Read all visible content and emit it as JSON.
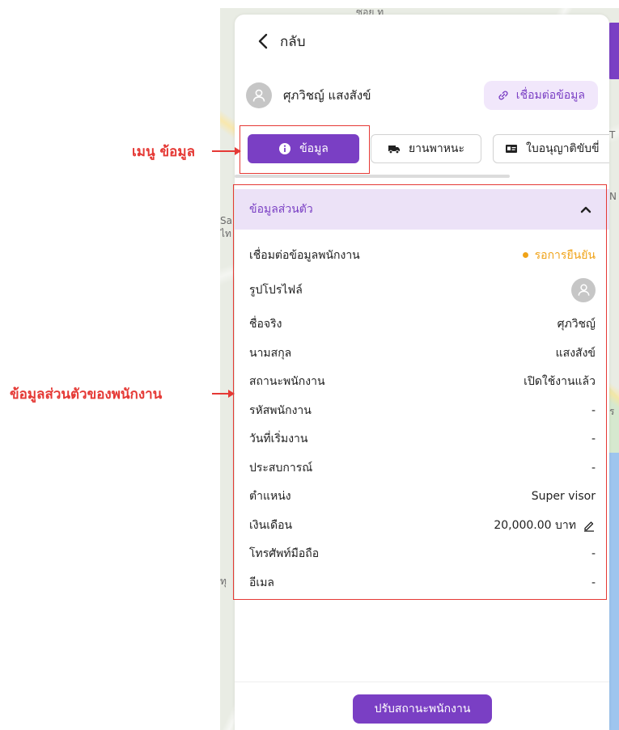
{
  "colors": {
    "accent": "#7a3fc4",
    "accent_soft": "#f1e7fb",
    "section_bg": "#ece2f7",
    "status_pending": "#f0a318",
    "annotation": "#e53935"
  },
  "header": {
    "back_label": "กลับ",
    "back_icon": "chevron-left-icon"
  },
  "profile": {
    "name": "ศุภวิชญ์ แสงสังข์",
    "avatar_icon": "user-avatar-icon",
    "connect_label": "เชื่อมต่อข้อมูล",
    "connect_icon": "link-icon"
  },
  "tabs": [
    {
      "label": "ข้อมูล",
      "icon": "info-icon",
      "active": true
    },
    {
      "label": "ยานพาหนะ",
      "icon": "truck-icon",
      "active": false
    },
    {
      "label": "ใบอนุญาติขับขี่",
      "icon": "id-card-icon",
      "active": false
    }
  ],
  "section": {
    "title": "ข้อมูลส่วนตัว",
    "toggle_icon": "chevron-up-icon"
  },
  "fields": [
    {
      "label": "เชื่อมต่อข้อมูลพนักงาน",
      "value": "รอการยืนยัน"
    },
    {
      "label": "รูปโปรไฟล์",
      "value": ""
    },
    {
      "label": "ชื่อจริง",
      "value": "ศุภวิชญ์"
    },
    {
      "label": "นามสกุล",
      "value": "แสงสังข์"
    },
    {
      "label": "สถานะพนักงาน",
      "value": "เปิดใช้งานแล้ว"
    },
    {
      "label": "รหัสพนักงาน",
      "value": "-"
    },
    {
      "label": "วันที่เริ่มงาน",
      "value": "-"
    },
    {
      "label": "ประสบการณ์",
      "value": "-"
    },
    {
      "label": "ตำแหน่ง",
      "value": "Super visor"
    },
    {
      "label": "เงินเดือน",
      "value": "20,000.00 บาท"
    },
    {
      "label": "โทรศัพท์มือถือ",
      "value": "-"
    },
    {
      "label": "อีเมล",
      "value": "-"
    }
  ],
  "footer": {
    "button_label": "ปรับสถานะพนักงาน"
  },
  "annotations": {
    "menu_label": "เมนู ข้อมูล",
    "section_label": "ข้อมูลส่วนตัวของพนักงาน"
  },
  "map_fragments": [
    "ซอย ท",
    "Sa",
    "ไท",
    "N",
    "T",
    "ร",
    "ทุ"
  ]
}
